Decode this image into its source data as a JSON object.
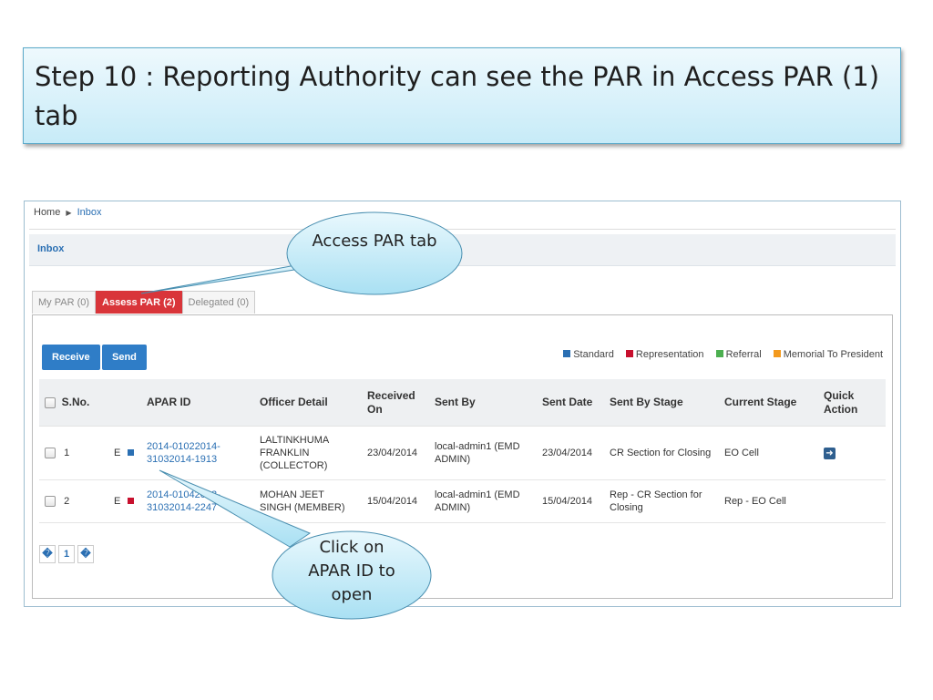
{
  "slide": {
    "title": "Step 10 : Reporting Authority can see the PAR in Access PAR (1) tab"
  },
  "breadcrumb": {
    "home": "Home",
    "current": "Inbox"
  },
  "panel": {
    "title": "Inbox"
  },
  "tabs": [
    {
      "label": "My PAR (0)",
      "active": false
    },
    {
      "label": "Assess PAR (2)",
      "active": true
    },
    {
      "label": "Delegated (0)",
      "active": false
    }
  ],
  "actions": {
    "receive": "Receive",
    "send": "Send"
  },
  "legend": [
    {
      "label": "Standard",
      "color": "#2a6fb3"
    },
    {
      "label": "Representation",
      "color": "#c8102e"
    },
    {
      "label": "Referral",
      "color": "#4caf50"
    },
    {
      "label": "Memorial To President",
      "color": "#f39a1e"
    }
  ],
  "table": {
    "headers": [
      "S.No.",
      "APAR ID",
      "Officer Detail",
      "Received On",
      "Sent By",
      "Sent Date",
      "Sent By Stage",
      "Current Stage",
      "Quick Action"
    ],
    "rows": [
      {
        "sno": "1",
        "flag": "E",
        "type_color": "#2a6fb3",
        "apar_id": "2014-01022014-31032014-1913",
        "officer": "LALTINKHUMA FRANKLIN (COLLECTOR)",
        "received_on": "23/04/2014",
        "sent_by": "local-admin1 (EMD ADMIN)",
        "sent_date": "23/04/2014",
        "sent_by_stage": "CR Section for Closing",
        "current_stage": "EO Cell",
        "quick_action_icon": "forward-icon"
      },
      {
        "sno": "2",
        "flag": "E",
        "type_color": "#c8102e",
        "apar_id": "2014-01042013-31032014-2247",
        "officer": "MOHAN JEET SINGH (MEMBER)",
        "received_on": "15/04/2014",
        "sent_by": "local-admin1 (EMD ADMIN)",
        "sent_date": "15/04/2014",
        "sent_by_stage": "Rep - CR Section for Closing",
        "current_stage": "Rep - EO Cell",
        "quick_action_icon": ""
      }
    ]
  },
  "pager": {
    "prev": "�",
    "page": "1",
    "next": "�"
  },
  "callouts": {
    "tab_note": "Access PAR tab",
    "apar_note": "Click on APAR ID to open"
  }
}
